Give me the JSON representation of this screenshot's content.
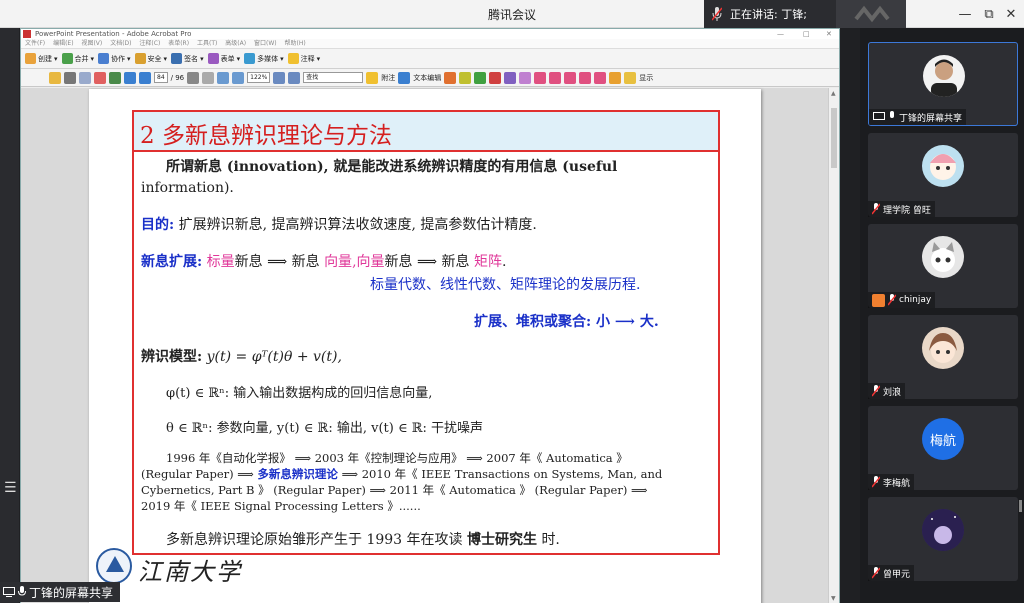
{
  "meeting": {
    "app_title": "腾讯会议",
    "speaking_label": "正在讲话: 丁锋;",
    "window_controls": [
      "—",
      "⧉",
      "✕"
    ],
    "share_label": "丁锋的屏幕共享"
  },
  "acrobat": {
    "window_title": "PowerPoint Presentation - Adobe Acrobat Pro",
    "title_controls": [
      "—",
      "□",
      "✕"
    ],
    "menu": [
      "文件(F)",
      "编辑(E)",
      "视图(V)",
      "文档(D)",
      "注释(C)",
      "表单(R)",
      "工具(T)",
      "高级(A)",
      "窗口(W)",
      "帮助(H)"
    ],
    "toolbar1": [
      "创建",
      "合并",
      "协作",
      "安全",
      "签名",
      "表单",
      "多媒体",
      "注释"
    ],
    "page_current": "84",
    "page_total": "/ 96",
    "zoom": "122%",
    "find_placeholder": "查找",
    "toolbar2_labels": [
      "附注",
      "文本编辑",
      "显示"
    ]
  },
  "slide": {
    "title": "2  多新息辨识理论与方法",
    "innov_def_a": "所谓新息 (innovation), 就是能改进系统辨识精度的有用信息 (useful",
    "innov_def_b": "information).",
    "goal_label": "目的:",
    "goal_text": "扩展辨识新息, 提高辨识算法收敛速度, 提高参数估计精度.",
    "ext_label": "新息扩展:",
    "ext_p1": "标量",
    "ext_p2": "新息 ⟹ 新息",
    "ext_p3": "向量",
    "ext_p4": ",",
    "ext_p5": "向量",
    "ext_p6": "新息 ⟹ 新息",
    "ext_p7": "矩阵",
    "ext_p8": ".",
    "ext_history": "标量代数、线性代数、矩阵理论的发展历程.",
    "ext_scale": "扩展、堆积或聚合: 小 ⟶ 大.",
    "model_label": "辨识模型:",
    "model_eq": "y(t) = φᵀ(t)θ + v(t),",
    "phi_line": "φ(t) ∈ ℝⁿ: 输入输出数据构成的回归信息向量,",
    "theta_line": "θ ∈ ℝⁿ: 参数向量,   y(t) ∈ ℝ: 输出,   v(t) ∈ ℝ: 干扰噪声",
    "hist_1": "1996 年《自动化学报》 ⟹ 2003 年《控制理论与应用》 ⟹ 2007 年《 Automatica 》",
    "hist_2a": "(Regular Paper) ⟹",
    "hist_2b": "多新息辨识理论",
    "hist_2c": "⟹ 2010 年《 IEEE Transactions on Systems, Man, and",
    "hist_3": "Cybernetics, Part B 》 (Regular Paper) ⟹ 2011 年《 Automatica 》 (Regular Paper) ⟹",
    "hist_4": "2019 年《 IEEE Signal Processing Letters 》......",
    "origin_a": "多新息辨识理论原始雏形产生于 1993 年在攻读",
    "origin_b": "博士研究生",
    "origin_c": "时.",
    "university": "江南大学"
  },
  "participants": [
    {
      "name": "丁锋的屏幕共享",
      "icon": "screen-share-icon",
      "avatar": "photo",
      "color": "#f0f0f0"
    },
    {
      "name": "理学院 曾旺",
      "icon": "mic-off-icon",
      "avatar": "cartoon",
      "color": "#bde0f0"
    },
    {
      "name": "chinjay",
      "icon": "mic-off-icon",
      "avatar": "cat",
      "color": "#e6e6e6"
    },
    {
      "name": "刘浪",
      "icon": "mic-off-icon",
      "avatar": "anime",
      "color": "#e9d8c8"
    },
    {
      "name": "李梅航",
      "icon": "mic-off-icon",
      "avatar": "梅航",
      "color": "#1f6fe5"
    },
    {
      "name": "曾甲元",
      "icon": "mic-off-icon",
      "avatar": "night",
      "color": "#3a2f6a"
    }
  ]
}
